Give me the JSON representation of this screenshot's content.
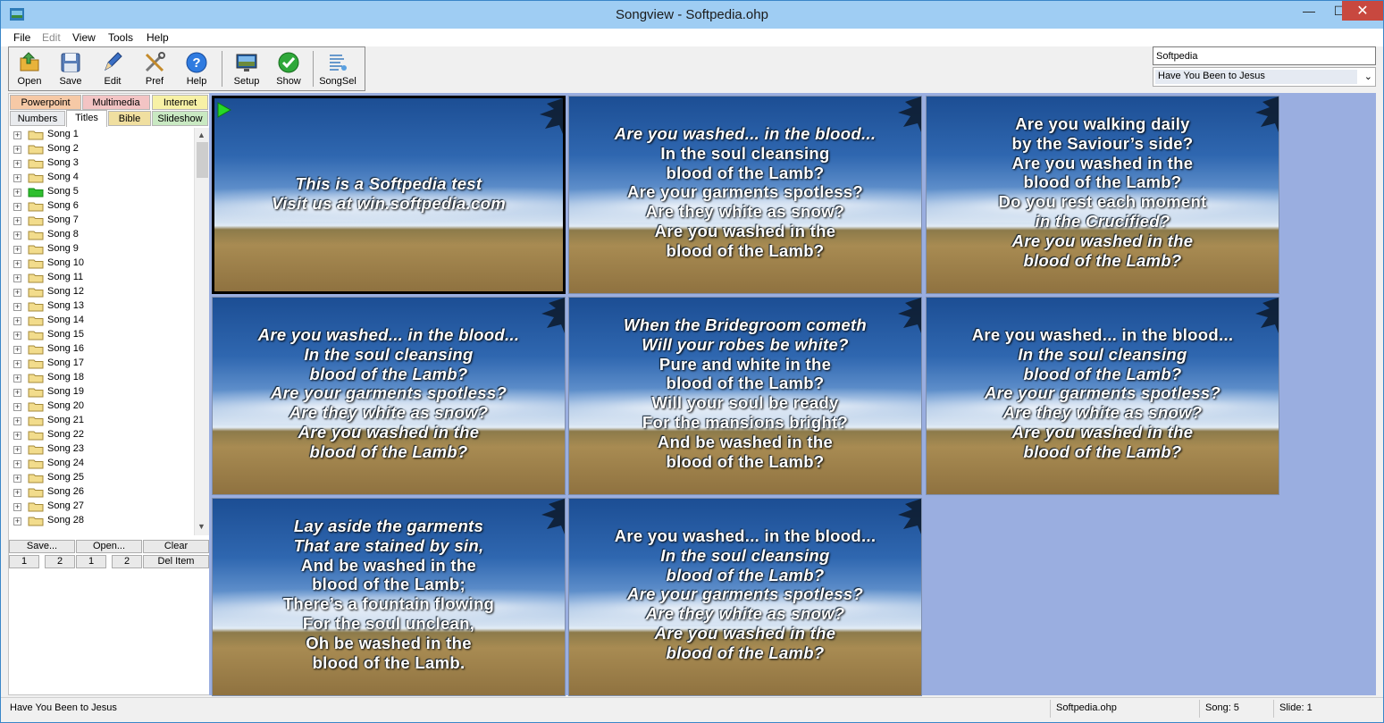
{
  "window": {
    "title": "Songview - Softpedia.ohp",
    "minimize": "—",
    "maximize": "☐",
    "close": "✕"
  },
  "menu": [
    "File",
    "Edit",
    "View",
    "Tools",
    "Help"
  ],
  "toolbar": [
    {
      "label": "Open",
      "icon": "open-folder-icon"
    },
    {
      "label": "Save",
      "icon": "save-disk-icon"
    },
    {
      "label": "Edit",
      "icon": "pencil-icon"
    },
    {
      "label": "Pref",
      "icon": "tools-icon"
    },
    {
      "label": "Help",
      "icon": "help-icon"
    },
    {
      "label": "Setup",
      "icon": "monitor-icon"
    },
    {
      "label": "Show",
      "icon": "checkmark-icon"
    },
    {
      "label": "SongSel",
      "icon": "songsel-icon"
    }
  ],
  "search": {
    "value": "Softpedia"
  },
  "song_select": {
    "value": "Have You Been to Jesus"
  },
  "tabs_row1": [
    {
      "label": "Powerpoint",
      "color": "#f6c9a6"
    },
    {
      "label": "Multimedia",
      "color": "#f3c4c4"
    },
    {
      "label": "Internet",
      "color": "#f7f1a6"
    }
  ],
  "tabs_row2": [
    {
      "label": "Numbers",
      "color": "#e9ebee"
    },
    {
      "label": "Titles",
      "color": "#ffffff"
    },
    {
      "label": "Bible",
      "color": "#f0dfa0"
    },
    {
      "label": "Slideshow",
      "color": "#c9e9c2"
    }
  ],
  "songs": [
    "Song 1",
    "Song 2",
    "Song 3",
    "Song 4",
    "Song 5",
    "Song 6",
    "Song 7",
    "Song 8",
    "Song 9",
    "Song 10",
    "Song 11",
    "Song 12",
    "Song 13",
    "Song 14",
    "Song 15",
    "Song 16",
    "Song 17",
    "Song 18",
    "Song 19",
    "Song 20",
    "Song 21",
    "Song 22",
    "Song 23",
    "Song 24",
    "Song 25",
    "Song 26",
    "Song 27",
    "Song 28"
  ],
  "active_song_index": 4,
  "list_buttons": {
    "save": "Save...",
    "open": "Open...",
    "clear": "Clear",
    "n1a": "1",
    "n2a": "2",
    "n1b": "1",
    "n2b": "2",
    "del": "Del Item"
  },
  "slides": [
    {
      "lines": [
        [
          "This is a Softpedia test",
          true
        ],
        [
          "Visit us at win.softpedia.com",
          true
        ]
      ],
      "selected": true
    },
    {
      "lines": [
        [
          "Are you washed... in the blood...",
          true
        ],
        [
          "In the soul cleansing",
          false
        ],
        [
          "blood of the Lamb?",
          false
        ],
        [
          "Are your garments spotless?",
          false
        ],
        [
          "Are they white as snow?",
          false
        ],
        [
          "Are you washed in the",
          false
        ],
        [
          "blood of the Lamb?",
          false
        ]
      ]
    },
    {
      "lines": [
        [
          "Are you walking daily",
          false
        ],
        [
          "by the Saviour’s side?",
          false
        ],
        [
          "Are you washed in the",
          false
        ],
        [
          "blood of the Lamb?",
          false
        ],
        [
          "Do you rest each moment",
          false
        ],
        [
          "in the Crucified?",
          true
        ],
        [
          "Are you washed in the",
          true
        ],
        [
          "blood of the Lamb?",
          true
        ]
      ]
    },
    {
      "lines": [
        [
          "Are you washed... in the blood...",
          true
        ],
        [
          "In the soul cleansing",
          true
        ],
        [
          "blood of the Lamb?",
          true
        ],
        [
          "Are your garments spotless?",
          true
        ],
        [
          "Are they white as snow?",
          true
        ],
        [
          "Are you washed in the",
          true
        ],
        [
          "blood of the Lamb?",
          true
        ]
      ]
    },
    {
      "lines": [
        [
          "When the Bridegroom cometh",
          true
        ],
        [
          "Will your robes be white?",
          true
        ],
        [
          "Pure and white in the",
          false
        ],
        [
          "blood of the Lamb?",
          false
        ],
        [
          "Will your soul be ready",
          false
        ],
        [
          "For the mansions bright?",
          false
        ],
        [
          "And be washed in the",
          false
        ],
        [
          "blood of the Lamb?",
          false
        ]
      ]
    },
    {
      "lines": [
        [
          "Are you washed... in the blood...",
          false
        ],
        [
          "In the soul cleansing",
          true
        ],
        [
          "blood of the Lamb?",
          true
        ],
        [
          "Are your garments spotless?",
          true
        ],
        [
          "Are they white as snow?",
          true
        ],
        [
          "Are you washed in the",
          true
        ],
        [
          "blood of the Lamb?",
          true
        ]
      ]
    },
    {
      "lines": [
        [
          "Lay aside the garments",
          true
        ],
        [
          "That are stained by sin,",
          true
        ],
        [
          "And be washed in the",
          false
        ],
        [
          "blood of the Lamb;",
          false
        ],
        [
          "There’s a fountain flowing",
          false
        ],
        [
          "For the soul unclean,",
          false
        ],
        [
          "Oh be washed in the",
          false
        ],
        [
          "blood of the Lamb.",
          false
        ]
      ]
    },
    {
      "lines": [
        [
          "Are you washed... in the blood...",
          false
        ],
        [
          "In the soul cleansing",
          true
        ],
        [
          "blood of the Lamb?",
          true
        ],
        [
          "Are your garments spotless?",
          true
        ],
        [
          "Are they white as snow?",
          true
        ],
        [
          "Are you washed in the",
          true
        ],
        [
          "blood of the Lamb?",
          true
        ]
      ]
    }
  ],
  "status": {
    "left": "Have You Been to Jesus",
    "file": "Softpedia.ohp",
    "song": "Song: 5",
    "slide": "Slide: 1"
  }
}
